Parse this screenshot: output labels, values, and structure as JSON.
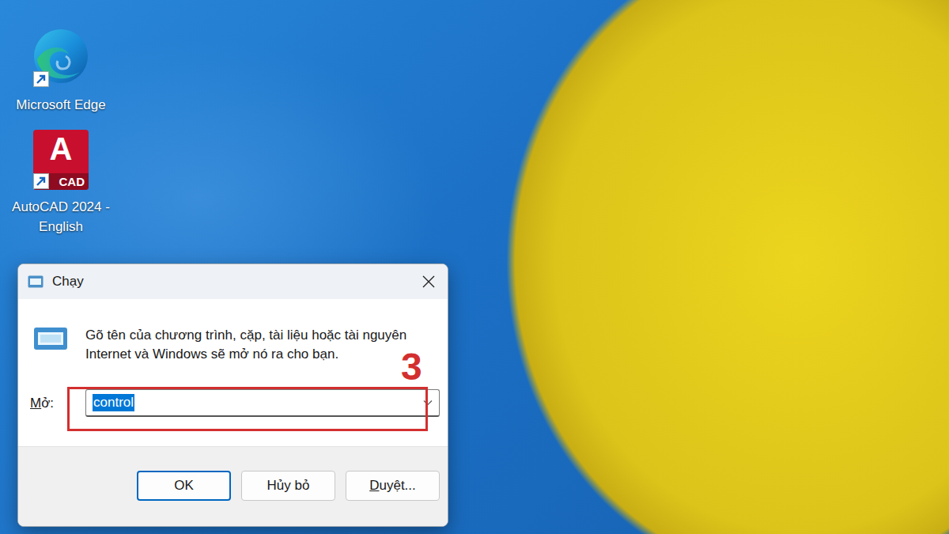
{
  "desktop_icons": [
    {
      "label": "Microsoft Edge",
      "kind": "edge"
    },
    {
      "label": "AutoCAD 2024 - English",
      "kind": "autocad",
      "logo_letter": "A",
      "logo_tag": "CAD"
    }
  ],
  "dialog": {
    "title": "Chạy",
    "description": "Gõ tên của chương trình, cặp, tài liệu hoặc tài nguyên Internet và Windows sẽ mở nó ra cho bạn.",
    "open_label": "Mở:",
    "open_mnemonic": "M",
    "input": {
      "value": "control",
      "selected": true
    },
    "buttons": [
      {
        "label": "OK",
        "default": true,
        "mnemonic": ""
      },
      {
        "label": "Hủy bỏ",
        "default": false,
        "mnemonic": ""
      },
      {
        "label": "Duyệt...",
        "default": false,
        "mnemonic": "D"
      }
    ]
  },
  "annotation": {
    "step": "3"
  }
}
